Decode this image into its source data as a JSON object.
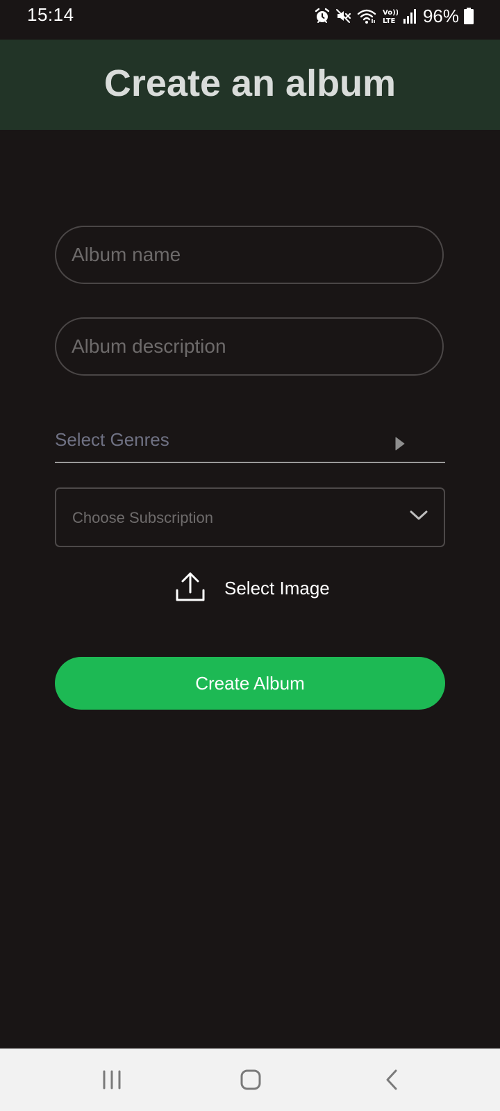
{
  "status_bar": {
    "time": "15:14",
    "battery": "96%",
    "icons": [
      "alarm-icon",
      "mute-icon",
      "wifi-icon",
      "volte-icon",
      "signal-icon",
      "battery-icon"
    ]
  },
  "header": {
    "title": "Create an album",
    "background": "#223427"
  },
  "form": {
    "album_name_placeholder": "Album name",
    "album_name_value": "",
    "album_description_placeholder": "Album description",
    "album_description_value": "",
    "genres_label": "Select Genres",
    "subscription_placeholder": "Choose Subscription",
    "select_image_label": "Select Image",
    "create_button_label": "Create Album",
    "accent_color": "#1db954"
  },
  "nav_bar": {
    "buttons": [
      "recents-icon",
      "home-icon",
      "back-icon"
    ]
  }
}
